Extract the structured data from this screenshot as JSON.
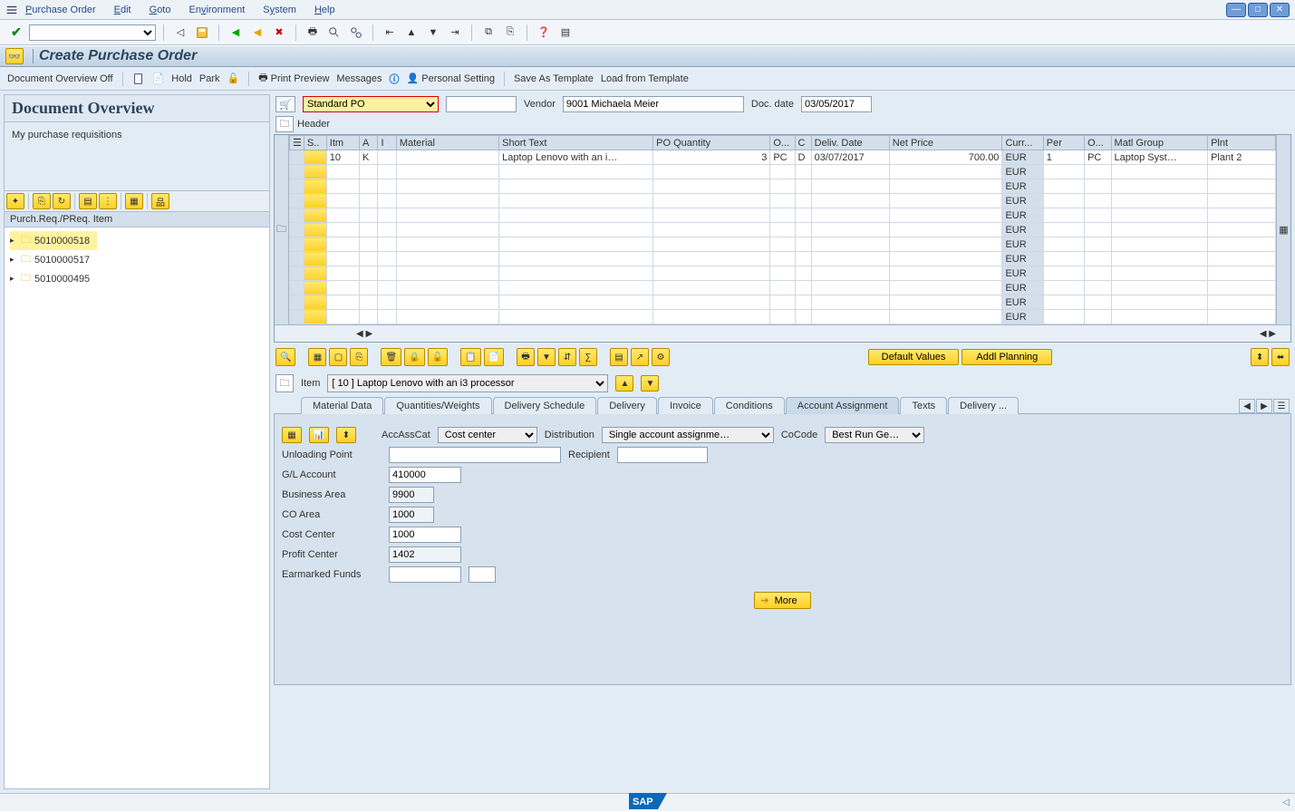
{
  "menu": {
    "items": [
      "Purchase Order",
      "Edit",
      "Goto",
      "Environment",
      "System",
      "Help"
    ]
  },
  "title": "Create Purchase Order",
  "appbar": {
    "doc_overview_off": "Document Overview Off",
    "hold": "Hold",
    "park": "Park",
    "print_preview": "Print Preview",
    "messages": "Messages",
    "personal_setting": "Personal Setting",
    "save_as_template": "Save As Template",
    "load_from_template": "Load from Template"
  },
  "left": {
    "heading": "Document Overview",
    "subtitle": "My purchase requisitions",
    "tree_header": "Purch.Req./PReq. Item",
    "nodes": [
      "5010000518",
      "5010000517",
      "5010000495"
    ]
  },
  "poheader": {
    "type_label": "Standard PO",
    "vendor_label": "Vendor",
    "vendor_value": "9001 Michaela Meier",
    "docdate_label": "Doc. date",
    "docdate_value": "03/05/2017",
    "header_toggle": "Header"
  },
  "columns": [
    "S..",
    "Itm",
    "A",
    "I",
    "Material",
    "Short Text",
    "PO Quantity",
    "O...",
    "C",
    "Deliv. Date",
    "Net Price",
    "Curr...",
    "Per",
    "O...",
    "Matl Group",
    "Plnt"
  ],
  "rows": [
    {
      "itm": "10",
      "a": "K",
      "i": "",
      "material": "",
      "short_text": "Laptop Lenovo with an i…",
      "qty": "3",
      "ou": "PC",
      "c": "D",
      "deliv": "03/07/2017",
      "price": "700.00",
      "curr": "EUR",
      "per": "1",
      "ou2": "PC",
      "mgrp": "Laptop Syst…",
      "plnt": "Plant 2"
    }
  ],
  "empty_currency": "EUR",
  "gridbuttons": {
    "default_values": "Default Values",
    "addl_planning": "Addl Planning"
  },
  "item_detail": {
    "label": "Item",
    "selected": "[ 10 ] Laptop Lenovo with an i3 processor"
  },
  "tabs": [
    "Material Data",
    "Quantities/Weights",
    "Delivery Schedule",
    "Delivery",
    "Invoice",
    "Conditions",
    "Account Assignment",
    "Texts",
    "Delivery ..."
  ],
  "active_tab": "Account Assignment",
  "account": {
    "accasscat_label": "AccAssCat",
    "accasscat_value": "Cost center",
    "distribution_label": "Distribution",
    "distribution_value": "Single account assignme…",
    "cocode_label": "CoCode",
    "cocode_value": "Best Run Ge…",
    "unloading_point_label": "Unloading Point",
    "unloading_point": "",
    "recipient_label": "Recipient",
    "recipient": "",
    "gl_account_label": "G/L Account",
    "gl_account": "410000",
    "business_area_label": "Business Area",
    "business_area": "9900",
    "co_area_label": "CO Area",
    "co_area": "1000",
    "cost_center_label": "Cost Center",
    "cost_center": "1000",
    "profit_center_label": "Profit Center",
    "profit_center": "1402",
    "earmarked_funds_label": "Earmarked Funds",
    "earmarked_funds": "",
    "more": "More"
  },
  "footer_logo": "SAP"
}
